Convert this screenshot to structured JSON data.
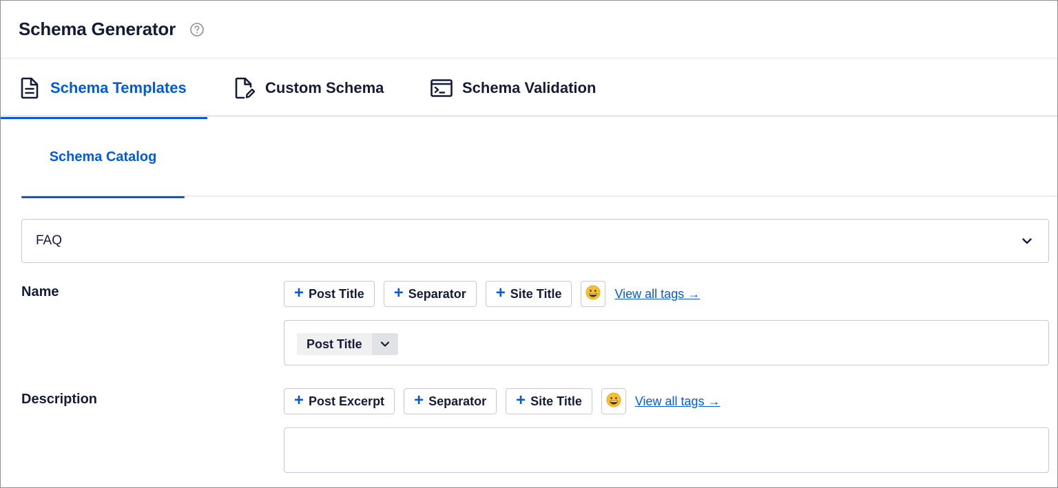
{
  "header": {
    "title": "Schema Generator",
    "help_icon": "question-circle-icon"
  },
  "main_tabs": [
    {
      "label": "Schema Templates",
      "icon": "document-icon",
      "active": true
    },
    {
      "label": "Custom Schema",
      "icon": "edit-document-icon",
      "active": false
    },
    {
      "label": "Schema Validation",
      "icon": "terminal-icon",
      "active": false
    }
  ],
  "sub_tabs": [
    {
      "label": "Schema Catalog",
      "active": true
    }
  ],
  "schema_select": {
    "value": "FAQ",
    "icon": "chevron-down-icon"
  },
  "fields": {
    "name": {
      "label": "Name",
      "tags": [
        "Post Title",
        "Separator",
        "Site Title"
      ],
      "view_all": "View all tags →",
      "chip": "Post Title"
    },
    "description": {
      "label": "Description",
      "tags": [
        "Post Excerpt",
        "Separator",
        "Site Title"
      ],
      "view_all": "View all tags →",
      "value": ""
    }
  },
  "colors": {
    "accent": "#005ae0",
    "text": "#141b38",
    "border": "#c6c9cf"
  }
}
